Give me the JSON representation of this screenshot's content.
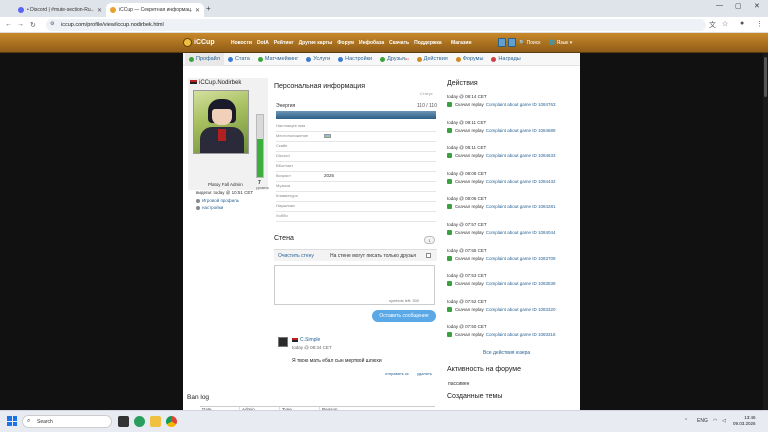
{
  "browser": {
    "tabs": [
      {
        "title": "• Discord | #mute-section-Ru...",
        "active": false
      },
      {
        "title": "iCCup — Секретная информац...",
        "active": true
      }
    ],
    "url": "iccup.com/profile/view/iccup.nodirbek.html"
  },
  "site": {
    "logo": "iCCup",
    "menu": [
      "Новости",
      "DotA",
      "Рейтинг",
      "Другие карты",
      "Форум",
      "Инфобаза",
      "Скачать",
      "Поддержка"
    ],
    "shop": "Магазин",
    "search": "Поиск",
    "lang": "Язык"
  },
  "subnav": [
    {
      "label": "Профайл",
      "active": true,
      "color": "#3aa33a"
    },
    {
      "label": "Стата",
      "active": false,
      "color": "#3a7ad0"
    },
    {
      "label": "Матчмейкинг",
      "active": false,
      "color": "#3aa33a"
    },
    {
      "label": "Услуги",
      "active": false,
      "color": "#3a7ad0"
    },
    {
      "label": "Настройки",
      "active": false,
      "color": "#3a7ad0"
    },
    {
      "label": "Друзья",
      "active": false,
      "color": "#3aa33a",
      "badge": "(1)"
    },
    {
      "label": "Действия",
      "active": false,
      "color": "#d08a20"
    },
    {
      "label": "Форумы",
      "active": false,
      "color": "#d08a20"
    },
    {
      "label": "Награды",
      "active": false,
      "color": "#d04040"
    }
  ],
  "profile": {
    "username": "iCCup.Nodirbek",
    "rank": "Platoy Fall Admin",
    "level": "7",
    "level_unit": "уровень",
    "level_fill": 0.62,
    "seen": "видели: today @ 10:51 CET",
    "links": [
      "Игровой профиль",
      "настройки"
    ]
  },
  "personal": {
    "title": "Персональная информация",
    "status": "Статус",
    "energy_label": "Энергия",
    "energy_value": "110 / 110",
    "energy_fill": 1.0,
    "fields": [
      {
        "label": "Настоящее имя",
        "value": ""
      },
      {
        "label": "Местоположение",
        "value": ""
      },
      {
        "label": "Скайп",
        "value": ""
      },
      {
        "label": "Discord",
        "value": ""
      },
      {
        "label": "ВКонтакт",
        "value": ""
      },
      {
        "label": "Возраст",
        "value": "2026"
      },
      {
        "label": "Музыка",
        "value": ""
      },
      {
        "label": "Клавиатура",
        "value": ""
      },
      {
        "label": "Наушники",
        "value": ""
      },
      {
        "label": "Хобби",
        "value": ""
      }
    ]
  },
  "wall": {
    "title": "Стена",
    "page": "1",
    "clear": "Очистить стену",
    "only_friends": "На стене могут писать только друзья",
    "limit": "symbols left: 300",
    "send": "Оставить сообщение",
    "comment": {
      "user": "C.Simple",
      "time": "today @ 08:34 CET",
      "text": "Я твою мать ебал сын мертвой шлюхи",
      "reply": "отправить кс",
      "delete": "удалить"
    }
  },
  "banlog": {
    "title": "Ban log",
    "columns": [
      "Date",
      "Admin",
      "Type",
      "Reason"
    ]
  },
  "actions": {
    "title": "Действия",
    "items": [
      {
        "time": "today @ 08:14 CET",
        "label": "Скачал replay",
        "game": "Complaint about game ID 1084763"
      },
      {
        "time": "today @ 08:11 CET",
        "label": "Скачал replay",
        "game": "Complaint about game ID 1084689"
      },
      {
        "time": "today @ 08:11 CET",
        "label": "Скачал replay",
        "game": "Complaint about game ID 1084633"
      },
      {
        "time": "today @ 08:08 CET",
        "label": "Скачал replay",
        "game": "Complaint about game ID 1084432"
      },
      {
        "time": "today @ 08:06 CET",
        "label": "Скачал replay",
        "game": "Complaint about game ID 1084281"
      },
      {
        "time": "today @ 07:57 CET",
        "label": "Скачал replay",
        "game": "Complaint about game ID 1084044"
      },
      {
        "time": "today @ 07:55 CET",
        "label": "Скачал replay",
        "game": "Complaint about game ID 1083709"
      },
      {
        "time": "today @ 07:53 CET",
        "label": "Скачал replay",
        "game": "Complaint about game ID 1083539"
      },
      {
        "time": "today @ 07:52 CET",
        "label": "Скачал replay",
        "game": "Complaint about game ID 1083320"
      },
      {
        "time": "today @ 07:50 CET",
        "label": "Скачал replay",
        "game": "Complaint about game ID 1083316"
      }
    ],
    "all": "Все действия юзера"
  },
  "forum_activity": {
    "title": "Активность на форуме",
    "value": "пассивен"
  },
  "created_topics": {
    "title": "Созданные темы"
  },
  "taskbar": {
    "search": "Search",
    "lang": "ENG",
    "time": "13:46",
    "date": "09.03.2026"
  }
}
